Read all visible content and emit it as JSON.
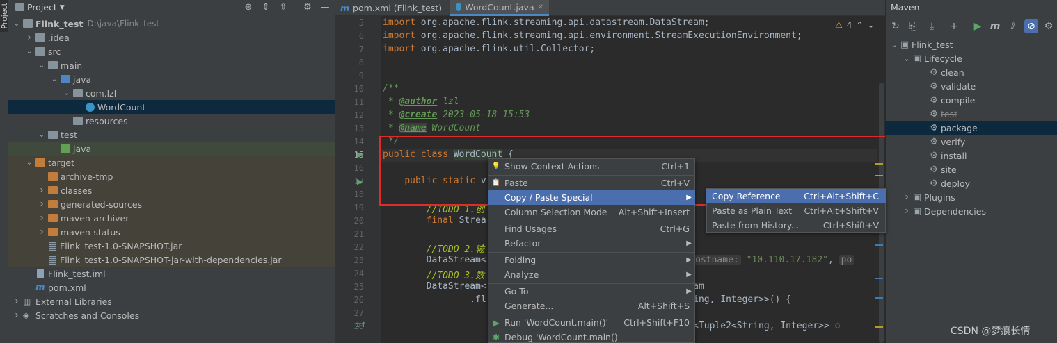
{
  "project_panel": {
    "title": "Project",
    "stripe_label": "Project",
    "tree": [
      {
        "label": "Flink_test",
        "note": "D:\\java\\Flink_test",
        "depth": 0,
        "arrow": "down",
        "icon": "module-folder-icon",
        "bold": true
      },
      {
        "label": ".idea",
        "depth": 1,
        "arrow": "right",
        "icon": "folder-icon"
      },
      {
        "label": "src",
        "depth": 1,
        "arrow": "down",
        "icon": "folder-icon"
      },
      {
        "label": "main",
        "depth": 2,
        "arrow": "down",
        "icon": "folder-icon"
      },
      {
        "label": "java",
        "depth": 3,
        "arrow": "down",
        "icon": "source-folder-icon"
      },
      {
        "label": "com.lzl",
        "depth": 4,
        "arrow": "down",
        "icon": "package-icon"
      },
      {
        "label": "WordCount",
        "depth": 5,
        "arrow": "",
        "icon": "java-class-icon",
        "selected": true
      },
      {
        "label": "resources",
        "depth": 4,
        "arrow": "",
        "icon": "resources-folder-icon"
      },
      {
        "label": "test",
        "depth": 2,
        "arrow": "down",
        "icon": "folder-icon"
      },
      {
        "label": "java",
        "depth": 3,
        "arrow": "",
        "icon": "test-folder-icon",
        "highlight": "green"
      },
      {
        "label": "target",
        "depth": 1,
        "arrow": "down",
        "icon": "excluded-folder-icon",
        "highlight": "orange"
      },
      {
        "label": "archive-tmp",
        "depth": 2,
        "arrow": "",
        "icon": "excluded-folder-icon",
        "highlight": "orange"
      },
      {
        "label": "classes",
        "depth": 2,
        "arrow": "right",
        "icon": "excluded-folder-icon",
        "highlight": "orange"
      },
      {
        "label": "generated-sources",
        "depth": 2,
        "arrow": "right",
        "icon": "excluded-folder-icon",
        "highlight": "orange"
      },
      {
        "label": "maven-archiver",
        "depth": 2,
        "arrow": "right",
        "icon": "excluded-folder-icon",
        "highlight": "orange"
      },
      {
        "label": "maven-status",
        "depth": 2,
        "arrow": "right",
        "icon": "excluded-folder-icon",
        "highlight": "orange"
      },
      {
        "label": "Flink_test-1.0-SNAPSHOT.jar",
        "depth": 2,
        "arrow": "",
        "icon": "jar-icon",
        "highlight": "orange"
      },
      {
        "label": "Flink_test-1.0-SNAPSHOT-jar-with-dependencies.jar",
        "depth": 2,
        "arrow": "",
        "icon": "jar-icon",
        "highlight": "orange"
      },
      {
        "label": "Flink_test.iml",
        "depth": 1,
        "arrow": "",
        "icon": "iml-file-icon"
      },
      {
        "label": "pom.xml",
        "depth": 1,
        "arrow": "",
        "icon": "maven-file-icon"
      },
      {
        "label": "External Libraries",
        "depth": 0,
        "arrow": "right",
        "icon": "libraries-icon"
      },
      {
        "label": "Scratches and Consoles",
        "depth": 0,
        "arrow": "right",
        "icon": "scratches-icon"
      }
    ]
  },
  "editor": {
    "tabs": [
      {
        "label": "pom.xml (Flink_test)",
        "icon": "maven-file-icon",
        "active": false
      },
      {
        "label": "WordCount.java",
        "icon": "java-class-icon",
        "active": true
      }
    ],
    "warnings_count": "4",
    "lines": [
      {
        "n": "5",
        "html": "<span class='kw'>import </span>org.apache.flink.streaming.api.datastream.DataStream;"
      },
      {
        "n": "6",
        "html": "<span class='kw'>import </span>org.apache.flink.streaming.api.environment.StreamExecutionEnvironment;"
      },
      {
        "n": "7",
        "html": "<span class='kw'>import </span>org.apache.flink.util.Collector;"
      },
      {
        "n": "8",
        "html": ""
      },
      {
        "n": "9",
        "html": ""
      },
      {
        "n": "10",
        "html": "<span class='cm'>/**</span>"
      },
      {
        "n": "11",
        "html": "<span class='cm'> * </span><span class='tg'>@author</span><span class='td'> lzl</span>"
      },
      {
        "n": "12",
        "html": "<span class='cm'> * </span><span class='tg'>@create</span><span class='td'> 2023-05-18 15:53</span>"
      },
      {
        "n": "13",
        "html": "<span class='cm'> * </span><span class='tg2'>@name</span><span class='td'> WordCount</span>"
      },
      {
        "n": "14",
        "html": "<span class='cm'> */</span>"
      },
      {
        "n": "15",
        "html": "<span class='kw'>public class </span><span class='cls'>WordCount</span> {"
      },
      {
        "n": "16",
        "html": ""
      },
      {
        "n": "17",
        "html": "    <span class='kw'>public static </span>v                               ion{"
      },
      {
        "n": "18",
        "html": ""
      },
      {
        "n": "19",
        "html": "        <span class='todo'>//TODO 1.创</span>"
      },
      {
        "n": "20",
        "html": "        <span class='kw'>final </span>Strea"
      },
      {
        "n": "21",
        "html": ""
      },
      {
        "n": "22",
        "html": "        <span class='todo'>//TODO 2.输</span>"
      },
      {
        "n": "23",
        "html": "        DataStream&lt;                               ream( <span class='hint'>hostname:</span> <span class='str'>\"10.110.17.182\"</span>, <span class='hint'>po</span>"
      },
      {
        "n": "24",
        "html": "        <span class='todo'>//TODO 3.数</span>"
      },
      {
        "n": "25",
        "html": "        DataStream&lt;                               ataStream"
      },
      {
        "n": "26",
        "html": "                .fl                               le2&lt;String, Integer&gt;&gt;() {"
      },
      {
        "n": "27",
        "html": ""
      },
      {
        "n": "28",
        "html": "                                                  llector&lt;Tuple2&lt;String, Integer&gt;&gt; <span class='kw'>o</span>"
      }
    ]
  },
  "context_menu": {
    "items": [
      {
        "label": "Show Context Actions",
        "shortcut": "Ctrl+1",
        "icon": "lightbulb-icon",
        "submenu": false
      },
      {
        "sep": true
      },
      {
        "label": "Paste",
        "u": "P",
        "shortcut": "Ctrl+V",
        "icon": "paste-icon",
        "submenu": false
      },
      {
        "label": "Copy / Paste Special",
        "shortcut": "",
        "icon": "",
        "submenu": true,
        "highlight": true
      },
      {
        "label": "Column Selection Mode",
        "shortcut": "Alt+Shift+Insert",
        "icon": "",
        "submenu": false
      },
      {
        "sep": true
      },
      {
        "label": "Find Usages",
        "shortcut": "Ctrl+G",
        "icon": "",
        "submenu": false
      },
      {
        "label": "Refactor",
        "shortcut": "",
        "icon": "",
        "submenu": true
      },
      {
        "sep": true
      },
      {
        "label": "Folding",
        "shortcut": "",
        "icon": "",
        "submenu": true
      },
      {
        "label": "Analyze",
        "shortcut": "",
        "icon": "",
        "submenu": true
      },
      {
        "sep": true
      },
      {
        "label": "Go To",
        "shortcut": "",
        "icon": "",
        "submenu": true
      },
      {
        "label": "Generate...",
        "shortcut": "Alt+Shift+S",
        "icon": "",
        "submenu": false
      },
      {
        "sep": true
      },
      {
        "label": "Run 'WordCount.main()'",
        "shortcut": "Ctrl+Shift+F10",
        "icon": "run-icon",
        "submenu": false
      },
      {
        "label": "Debug 'WordCount.main()'",
        "shortcut": "",
        "icon": "debug-icon",
        "submenu": false
      }
    ]
  },
  "submenu": {
    "items": [
      {
        "label": "Copy Reference",
        "shortcut": "Ctrl+Alt+Shift+C",
        "highlight": true
      },
      {
        "label": "Paste as Plain Text",
        "shortcut": "Ctrl+Alt+Shift+V"
      },
      {
        "label": "Paste from History...",
        "shortcut": "Ctrl+Shift+V"
      }
    ]
  },
  "maven": {
    "title": "Maven",
    "tree": [
      {
        "label": "Flink_test",
        "depth": 0,
        "arrow": "down",
        "icon": "maven-project-icon"
      },
      {
        "label": "Lifecycle",
        "depth": 1,
        "arrow": "down",
        "icon": "lifecycle-folder-icon"
      },
      {
        "label": "clean",
        "depth": 2,
        "icon": "gear-icon"
      },
      {
        "label": "validate",
        "depth": 2,
        "icon": "gear-icon"
      },
      {
        "label": "compile",
        "depth": 2,
        "icon": "gear-icon"
      },
      {
        "label": "test",
        "depth": 2,
        "icon": "gear-icon",
        "strike": true
      },
      {
        "label": "package",
        "depth": 2,
        "icon": "gear-icon",
        "selected": true
      },
      {
        "label": "verify",
        "depth": 2,
        "icon": "gear-icon"
      },
      {
        "label": "install",
        "depth": 2,
        "icon": "gear-icon"
      },
      {
        "label": "site",
        "depth": 2,
        "icon": "gear-icon"
      },
      {
        "label": "deploy",
        "depth": 2,
        "icon": "gear-icon"
      },
      {
        "label": "Plugins",
        "depth": 1,
        "arrow": "right",
        "icon": "plugins-folder-icon"
      },
      {
        "label": "Dependencies",
        "depth": 1,
        "arrow": "right",
        "icon": "dependencies-folder-icon"
      }
    ]
  },
  "watermark": "CSDN @梦痕长情",
  "colors": {
    "selection": "#0d293e",
    "menu_highlight": "#4b6eaf",
    "red_annotation": "#e02b2b"
  }
}
